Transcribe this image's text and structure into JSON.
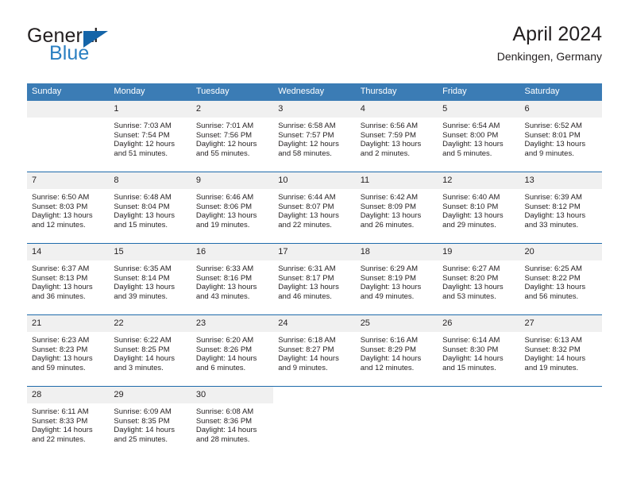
{
  "brand": {
    "name_top": "General",
    "name_bottom": "Blue",
    "triangle_icon": "triangle-icon",
    "color_top": "#231f20",
    "color_bottom": "#2a7fc1",
    "triangle_color": "#1565a8"
  },
  "header": {
    "title": "April 2024",
    "subtitle": "Denkingen, Germany"
  },
  "theme": {
    "header_bg": "#3b7cb5",
    "row_divider": "#1f6bab",
    "daynum_bg": "#f0f0f0",
    "text": "#231f20"
  },
  "weekdays": [
    "Sunday",
    "Monday",
    "Tuesday",
    "Wednesday",
    "Thursday",
    "Friday",
    "Saturday"
  ],
  "weeks": [
    [
      {
        "day": "",
        "lines": []
      },
      {
        "day": "1",
        "lines": [
          "Sunrise: 7:03 AM",
          "Sunset: 7:54 PM",
          "Daylight: 12 hours",
          "and 51 minutes."
        ]
      },
      {
        "day": "2",
        "lines": [
          "Sunrise: 7:01 AM",
          "Sunset: 7:56 PM",
          "Daylight: 12 hours",
          "and 55 minutes."
        ]
      },
      {
        "day": "3",
        "lines": [
          "Sunrise: 6:58 AM",
          "Sunset: 7:57 PM",
          "Daylight: 12 hours",
          "and 58 minutes."
        ]
      },
      {
        "day": "4",
        "lines": [
          "Sunrise: 6:56 AM",
          "Sunset: 7:59 PM",
          "Daylight: 13 hours",
          "and 2 minutes."
        ]
      },
      {
        "day": "5",
        "lines": [
          "Sunrise: 6:54 AM",
          "Sunset: 8:00 PM",
          "Daylight: 13 hours",
          "and 5 minutes."
        ]
      },
      {
        "day": "6",
        "lines": [
          "Sunrise: 6:52 AM",
          "Sunset: 8:01 PM",
          "Daylight: 13 hours",
          "and 9 minutes."
        ]
      }
    ],
    [
      {
        "day": "7",
        "lines": [
          "Sunrise: 6:50 AM",
          "Sunset: 8:03 PM",
          "Daylight: 13 hours",
          "and 12 minutes."
        ]
      },
      {
        "day": "8",
        "lines": [
          "Sunrise: 6:48 AM",
          "Sunset: 8:04 PM",
          "Daylight: 13 hours",
          "and 15 minutes."
        ]
      },
      {
        "day": "9",
        "lines": [
          "Sunrise: 6:46 AM",
          "Sunset: 8:06 PM",
          "Daylight: 13 hours",
          "and 19 minutes."
        ]
      },
      {
        "day": "10",
        "lines": [
          "Sunrise: 6:44 AM",
          "Sunset: 8:07 PM",
          "Daylight: 13 hours",
          "and 22 minutes."
        ]
      },
      {
        "day": "11",
        "lines": [
          "Sunrise: 6:42 AM",
          "Sunset: 8:09 PM",
          "Daylight: 13 hours",
          "and 26 minutes."
        ]
      },
      {
        "day": "12",
        "lines": [
          "Sunrise: 6:40 AM",
          "Sunset: 8:10 PM",
          "Daylight: 13 hours",
          "and 29 minutes."
        ]
      },
      {
        "day": "13",
        "lines": [
          "Sunrise: 6:39 AM",
          "Sunset: 8:12 PM",
          "Daylight: 13 hours",
          "and 33 minutes."
        ]
      }
    ],
    [
      {
        "day": "14",
        "lines": [
          "Sunrise: 6:37 AM",
          "Sunset: 8:13 PM",
          "Daylight: 13 hours",
          "and 36 minutes."
        ]
      },
      {
        "day": "15",
        "lines": [
          "Sunrise: 6:35 AM",
          "Sunset: 8:14 PM",
          "Daylight: 13 hours",
          "and 39 minutes."
        ]
      },
      {
        "day": "16",
        "lines": [
          "Sunrise: 6:33 AM",
          "Sunset: 8:16 PM",
          "Daylight: 13 hours",
          "and 43 minutes."
        ]
      },
      {
        "day": "17",
        "lines": [
          "Sunrise: 6:31 AM",
          "Sunset: 8:17 PM",
          "Daylight: 13 hours",
          "and 46 minutes."
        ]
      },
      {
        "day": "18",
        "lines": [
          "Sunrise: 6:29 AM",
          "Sunset: 8:19 PM",
          "Daylight: 13 hours",
          "and 49 minutes."
        ]
      },
      {
        "day": "19",
        "lines": [
          "Sunrise: 6:27 AM",
          "Sunset: 8:20 PM",
          "Daylight: 13 hours",
          "and 53 minutes."
        ]
      },
      {
        "day": "20",
        "lines": [
          "Sunrise: 6:25 AM",
          "Sunset: 8:22 PM",
          "Daylight: 13 hours",
          "and 56 minutes."
        ]
      }
    ],
    [
      {
        "day": "21",
        "lines": [
          "Sunrise: 6:23 AM",
          "Sunset: 8:23 PM",
          "Daylight: 13 hours",
          "and 59 minutes."
        ]
      },
      {
        "day": "22",
        "lines": [
          "Sunrise: 6:22 AM",
          "Sunset: 8:25 PM",
          "Daylight: 14 hours",
          "and 3 minutes."
        ]
      },
      {
        "day": "23",
        "lines": [
          "Sunrise: 6:20 AM",
          "Sunset: 8:26 PM",
          "Daylight: 14 hours",
          "and 6 minutes."
        ]
      },
      {
        "day": "24",
        "lines": [
          "Sunrise: 6:18 AM",
          "Sunset: 8:27 PM",
          "Daylight: 14 hours",
          "and 9 minutes."
        ]
      },
      {
        "day": "25",
        "lines": [
          "Sunrise: 6:16 AM",
          "Sunset: 8:29 PM",
          "Daylight: 14 hours",
          "and 12 minutes."
        ]
      },
      {
        "day": "26",
        "lines": [
          "Sunrise: 6:14 AM",
          "Sunset: 8:30 PM",
          "Daylight: 14 hours",
          "and 15 minutes."
        ]
      },
      {
        "day": "27",
        "lines": [
          "Sunrise: 6:13 AM",
          "Sunset: 8:32 PM",
          "Daylight: 14 hours",
          "and 19 minutes."
        ]
      }
    ],
    [
      {
        "day": "28",
        "lines": [
          "Sunrise: 6:11 AM",
          "Sunset: 8:33 PM",
          "Daylight: 14 hours",
          "and 22 minutes."
        ]
      },
      {
        "day": "29",
        "lines": [
          "Sunrise: 6:09 AM",
          "Sunset: 8:35 PM",
          "Daylight: 14 hours",
          "and 25 minutes."
        ]
      },
      {
        "day": "30",
        "lines": [
          "Sunrise: 6:08 AM",
          "Sunset: 8:36 PM",
          "Daylight: 14 hours",
          "and 28 minutes."
        ]
      },
      {
        "day": "",
        "lines": []
      },
      {
        "day": "",
        "lines": []
      },
      {
        "day": "",
        "lines": []
      },
      {
        "day": "",
        "lines": []
      }
    ]
  ]
}
